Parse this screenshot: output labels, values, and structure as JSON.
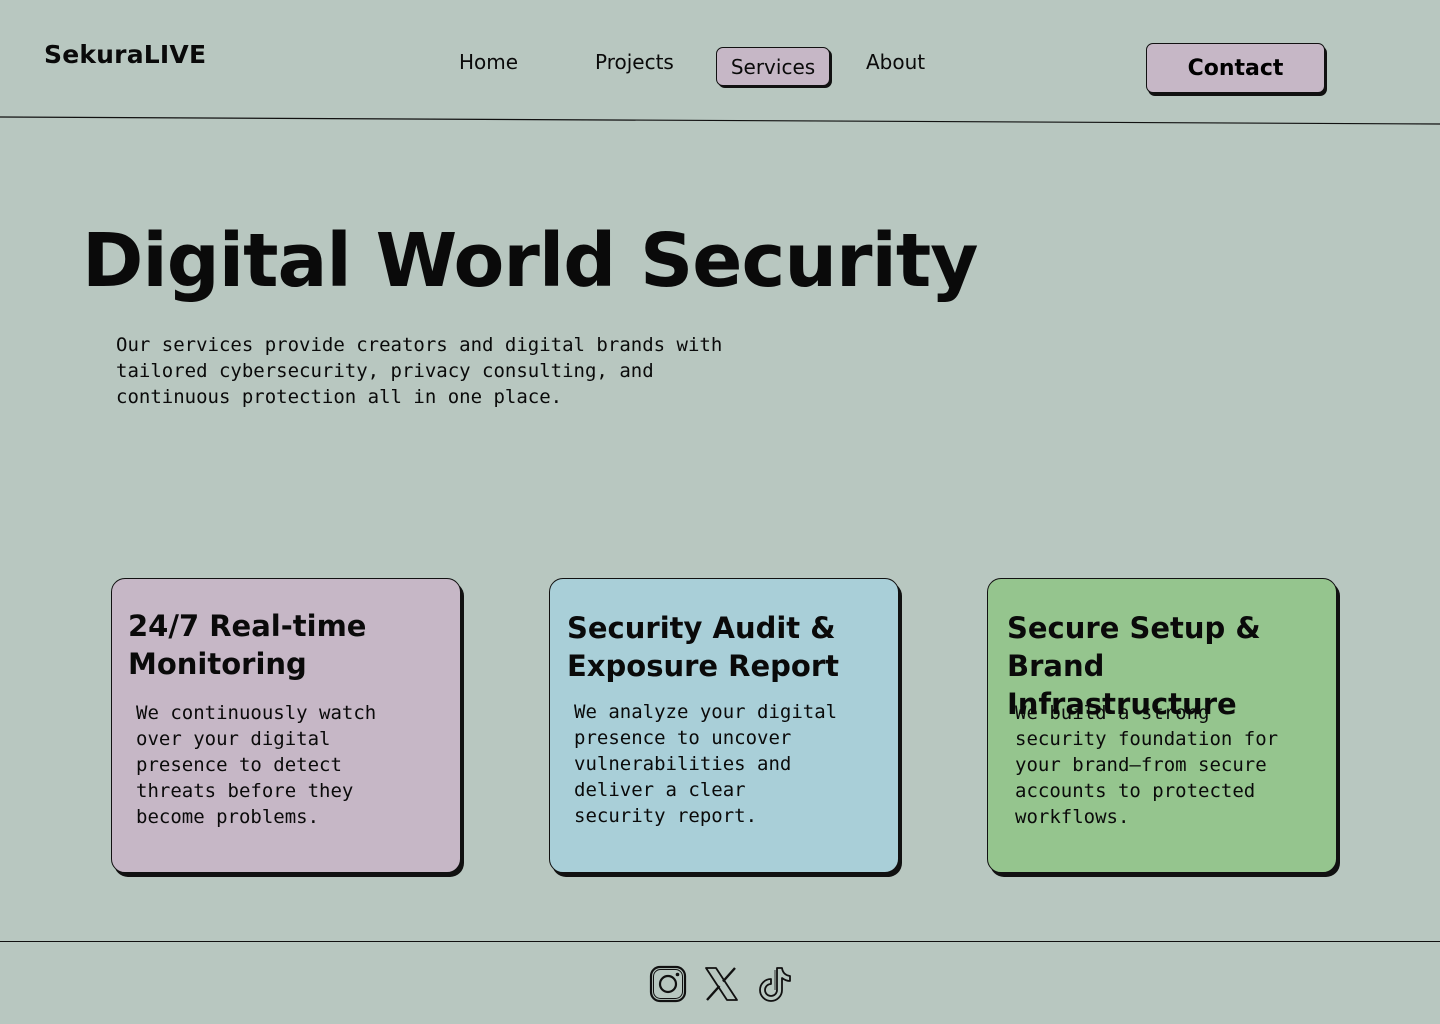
{
  "header": {
    "logo": "SekuraLIVE",
    "nav": {
      "home": "Home",
      "projects": "Projects",
      "services": "Services",
      "about": "About"
    },
    "contact_label": "Contact"
  },
  "hero": {
    "title": "Digital World Security",
    "description": "Our services provide creators and digital brands with\ntailored cybersecurity, privacy consulting, and\ncontinuous protection all in one place."
  },
  "cards": [
    {
      "title": "24/7 Real-time\nMonitoring",
      "description": "We continuously watch\nover your digital\npresence to detect\nthreats before they\nbecome problems.",
      "color": "#c6b7c6"
    },
    {
      "title": "Security Audit &\nExposure Report",
      "description": "We analyze your digital\npresence to uncover\nvulnerabilities and\ndeliver a clear\nsecurity report.",
      "color": "#a9cfd8"
    },
    {
      "title": "Secure Setup & Brand\nInfrastructure",
      "description": "We build a strong\nsecurity foundation for\nyour brand—from secure\naccounts to protected\nworkflows.",
      "color": "#95c58e"
    }
  ],
  "footer": {
    "social_icons": [
      "instagram-icon",
      "x-icon",
      "tiktok-icon"
    ]
  },
  "colors": {
    "background": "#b8c7c0",
    "accent": "#c6b7c6",
    "text": "#0a0a0a"
  }
}
